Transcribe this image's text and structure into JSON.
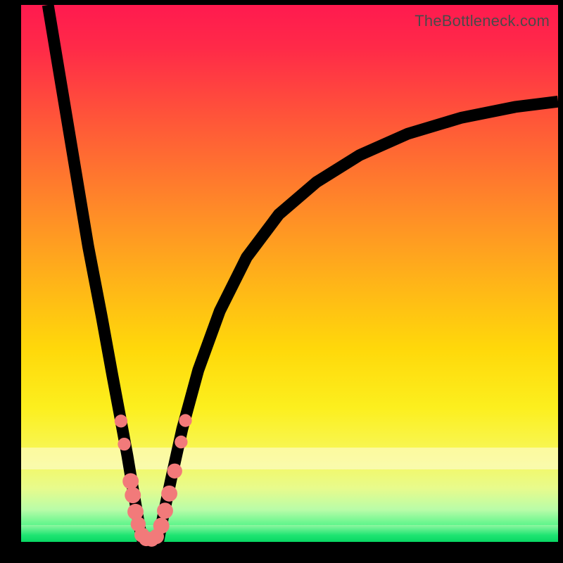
{
  "watermark": "TheBottleneck.com",
  "colors": {
    "gradient_top": "#ff1a4f",
    "gradient_bottom": "#0ee46a",
    "curve": "#000000",
    "bead": "#f27a7a",
    "frame_bg": "#000000"
  },
  "chart_data": {
    "type": "line",
    "title": "",
    "xlabel": "",
    "ylabel": "",
    "xlim": [
      0,
      100
    ],
    "ylim": [
      0,
      100
    ],
    "grid": false,
    "legend": false,
    "note": "Axes have no tick labels; values are relative percentages read from pixel position. y=0 is the green band (bottom), y=100 is the top edge. x is horizontal position across the gradient panel.",
    "series": [
      {
        "name": "left-curve",
        "x": [
          5.0,
          7.5,
          10.0,
          12.5,
          15.0,
          17.0,
          18.5,
          19.8,
          20.8,
          21.5,
          22.0,
          22.7
        ],
        "values": [
          100,
          85,
          70,
          55,
          42,
          31,
          23,
          16,
          10,
          6,
          3,
          0
        ]
      },
      {
        "name": "right-curve",
        "x": [
          25.5,
          26.5,
          28.0,
          30.0,
          33.0,
          37.0,
          42.0,
          48.0,
          55.0,
          63.0,
          72.0,
          82.0,
          92.0,
          100.0
        ],
        "values": [
          0,
          5,
          12,
          21,
          32,
          43,
          53,
          61,
          67,
          72,
          76,
          79,
          81,
          82
        ]
      }
    ],
    "beads_note": "Salmon dots clustered near the trough on both branches; positions approximate.",
    "beads": [
      {
        "x": 18.6,
        "y": 22.5,
        "r": 1.2
      },
      {
        "x": 19.2,
        "y": 18.2,
        "r": 1.2
      },
      {
        "x": 20.4,
        "y": 11.3,
        "r": 1.5
      },
      {
        "x": 20.8,
        "y": 8.7,
        "r": 1.5
      },
      {
        "x": 21.3,
        "y": 5.6,
        "r": 1.5
      },
      {
        "x": 21.8,
        "y": 3.3,
        "r": 1.4
      },
      {
        "x": 22.5,
        "y": 1.3,
        "r": 1.4
      },
      {
        "x": 23.3,
        "y": 0.6,
        "r": 1.4
      },
      {
        "x": 24.3,
        "y": 0.5,
        "r": 1.4
      },
      {
        "x": 25.2,
        "y": 1.0,
        "r": 1.4
      },
      {
        "x": 26.1,
        "y": 3.0,
        "r": 1.5
      },
      {
        "x": 26.8,
        "y": 5.8,
        "r": 1.5
      },
      {
        "x": 27.6,
        "y": 9.0,
        "r": 1.5
      },
      {
        "x": 28.6,
        "y": 13.2,
        "r": 1.4
      },
      {
        "x": 29.8,
        "y": 18.6,
        "r": 1.2
      },
      {
        "x": 30.6,
        "y": 22.6,
        "r": 1.2
      }
    ]
  }
}
